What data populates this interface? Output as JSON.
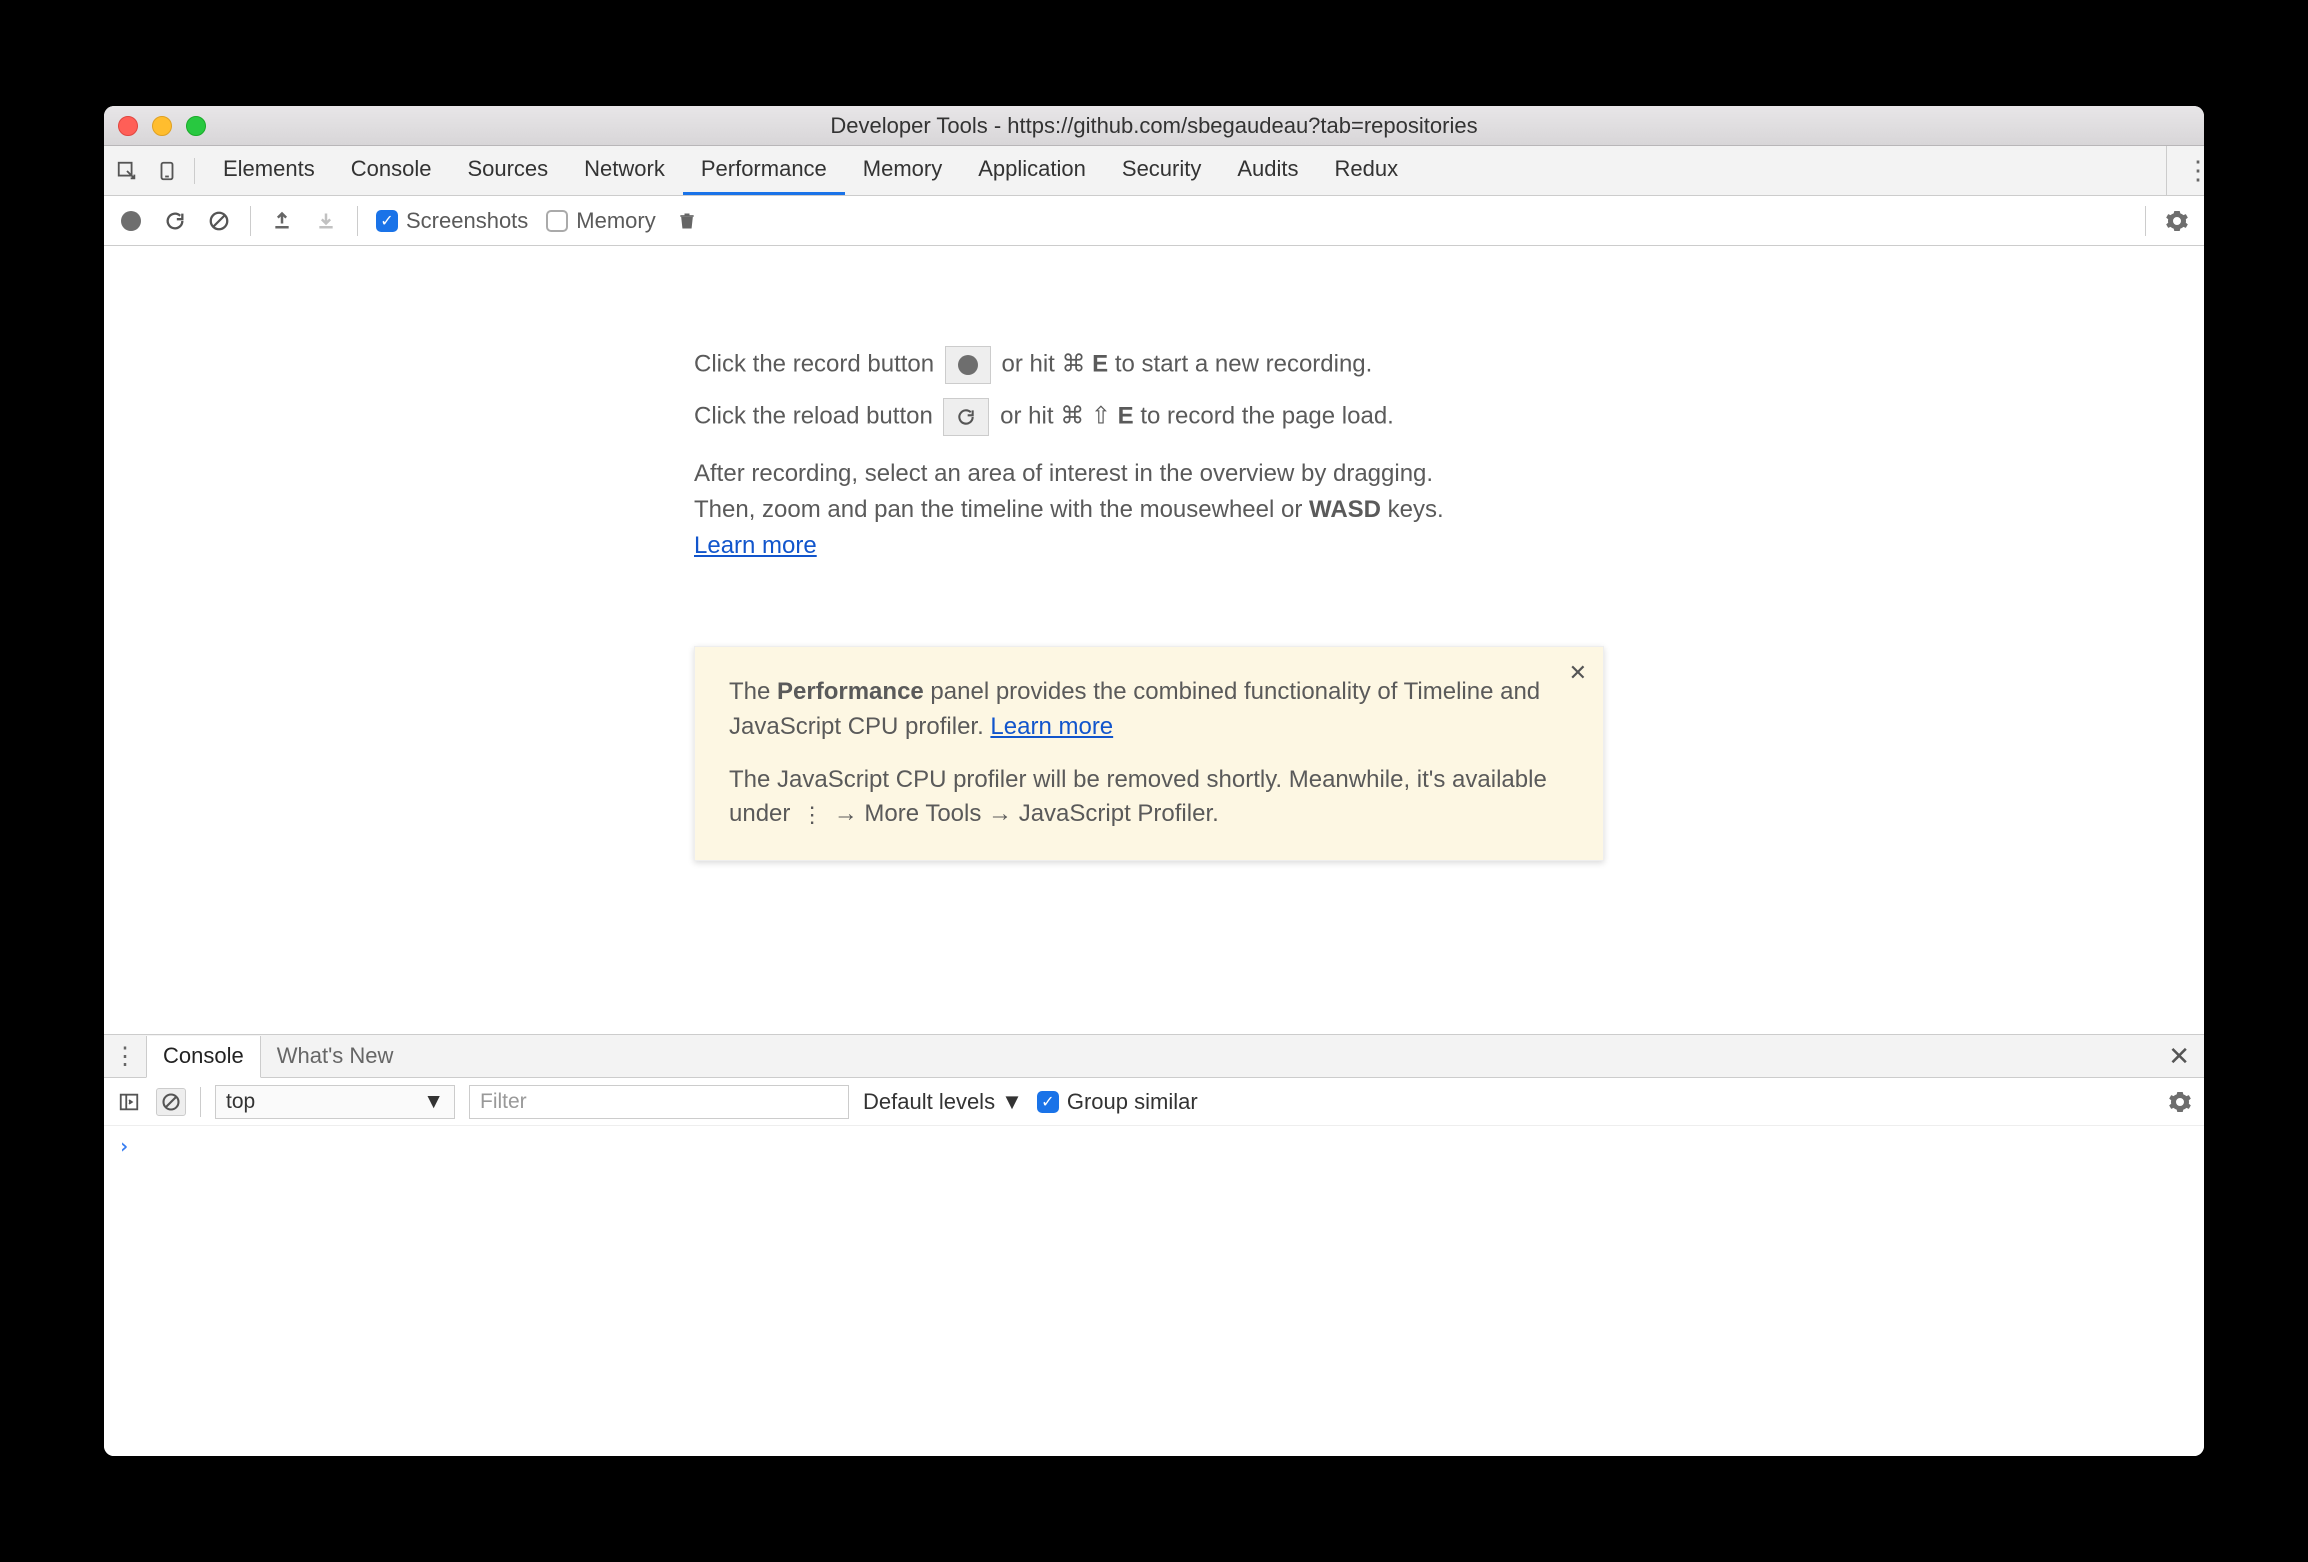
{
  "window": {
    "title": "Developer Tools - https://github.com/sbegaudeau?tab=repositories"
  },
  "tabs": {
    "items": [
      "Elements",
      "Console",
      "Sources",
      "Network",
      "Performance",
      "Memory",
      "Application",
      "Security",
      "Audits",
      "Redux"
    ],
    "active": "Performance"
  },
  "subtoolbar": {
    "screenshots_label": "Screenshots",
    "memory_label": "Memory"
  },
  "perf": {
    "line1_pre": "Click the record button ",
    "line1_post": " or hit ",
    "line1_cmd": "⌘",
    "line1_key": "E",
    "line1_end": " to start a new recording.",
    "line2_pre": "Click the reload button ",
    "line2_post": " or hit ",
    "line2_cmd": "⌘",
    "line2_shift": "⇧",
    "line2_key": "E",
    "line2_end": " to record the page load.",
    "line3_a": "After recording, select an area of interest in the overview by dragging.",
    "line3_b_pre": "Then, zoom and pan the timeline with the mousewheel or ",
    "line3_b_bold": "WASD",
    "line3_b_post": " keys.",
    "learn_more": "Learn more"
  },
  "notice": {
    "p1_pre": "The ",
    "p1_bold": "Performance",
    "p1_post": " panel provides the combined functionality of Timeline and JavaScript CPU profiler. ",
    "p1_link": "Learn more",
    "p2_pre": "The JavaScript CPU profiler will be removed shortly. Meanwhile, it's available under ",
    "p2_more_tools": "More Tools",
    "p2_profiler": "JavaScript Profiler."
  },
  "drawer": {
    "tabs": [
      "Console",
      "What's New"
    ],
    "active": "Console"
  },
  "console": {
    "context": "top",
    "filter_placeholder": "Filter",
    "levels_label": "Default levels",
    "group_similar_label": "Group similar",
    "prompt": "›"
  }
}
